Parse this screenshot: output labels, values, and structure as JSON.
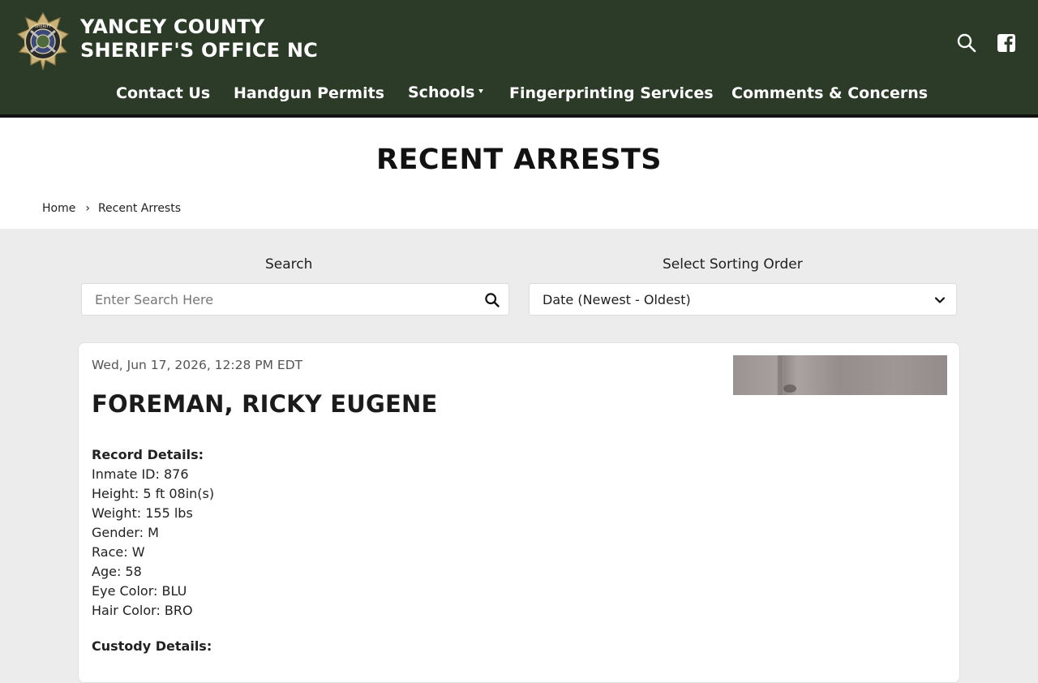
{
  "header": {
    "title_line1": "YANCEY COUNTY",
    "title_line2": "SHERIFF'S OFFICE NC",
    "logo_icon": "sheriff-badge-icon",
    "search_icon": "search-icon",
    "social_icon": "facebook-icon",
    "colors": {
      "bar": "#2c3b28",
      "text": "#ffffff"
    }
  },
  "nav": {
    "items": [
      {
        "label": "Contact Us"
      },
      {
        "label": "Handgun Permits"
      },
      {
        "label": "Schools",
        "has_dropdown": true
      },
      {
        "label": "Fingerprinting Services"
      },
      {
        "label": "Comments & Concerns"
      }
    ]
  },
  "page": {
    "title": "RECENT ARRESTS",
    "breadcrumb": {
      "home": "Home",
      "separator": "›",
      "current": "Recent Arrests"
    }
  },
  "filters": {
    "search_label": "Search",
    "search_placeholder": "Enter Search Here",
    "search_value": "",
    "sort_label": "Select Sorting Order",
    "sort_value": "Date (Newest - Oldest)"
  },
  "record": {
    "date": "Wed, Jun 17, 2026, 12:28 PM EDT",
    "name": "FOREMAN, RICKY EUGENE",
    "details_heading": "Record Details:",
    "details": [
      "Inmate ID: 876",
      "Height: 5 ft 08in(s)",
      "Weight: 155 lbs",
      "Gender: M",
      "Race: W",
      "Age: 58",
      "Eye Color: BLU",
      "Hair Color: BRO"
    ],
    "custody_heading": "Custody Details:"
  }
}
